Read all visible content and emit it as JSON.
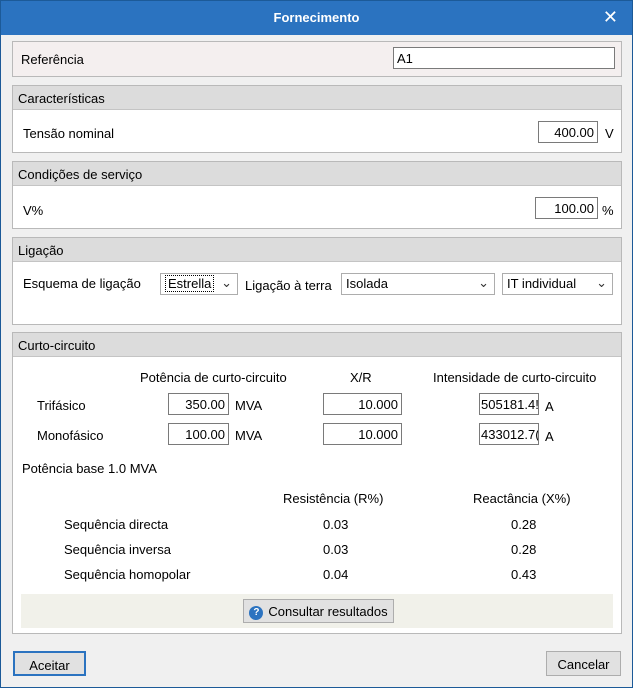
{
  "window": {
    "title": "Fornecimento",
    "close_glyph": "✕"
  },
  "referencia": {
    "label": "Referência",
    "value": "A1"
  },
  "caracteristicas": {
    "header": "Características",
    "tensao_label": "Tensão nominal",
    "tensao_value": "400.00",
    "tensao_unit": "V"
  },
  "condicoes": {
    "header": "Condições de serviço",
    "v_label": "V%",
    "v_value": "100.00",
    "v_unit": "%"
  },
  "ligacao": {
    "header": "Ligação",
    "esquema_label": "Esquema de ligação",
    "esquema_value": "Estrella",
    "terra_label": "Ligação à terra",
    "terra_value": "Isolada",
    "it_value": "IT individual"
  },
  "curto": {
    "header": "Curto-circuito",
    "col_potencia": "Potência de curto-circuito",
    "col_xr": "X/R",
    "col_intensidade": "Intensidade de curto-circuito",
    "rows": [
      {
        "label": "Trifásico",
        "potencia": "350.00",
        "potencia_unit": "MVA",
        "xr": "10.000",
        "intensidade": "505181.4!",
        "intensidade_unit": "A"
      },
      {
        "label": "Monofásico",
        "potencia": "100.00",
        "potencia_unit": "MVA",
        "xr": "10.000",
        "intensidade": "433012.7(",
        "intensidade_unit": "A"
      }
    ],
    "potencia_base": "Potência base  1.0 MVA",
    "col_resistencia": "Resistência (R%)",
    "col_reactancia": "Reactância (X%)",
    "sequences": [
      {
        "label": "Sequência directa",
        "r": "0.03",
        "x": "0.28"
      },
      {
        "label": "Sequência inversa",
        "r": "0.03",
        "x": "0.28"
      },
      {
        "label": "Sequência homopolar",
        "r": "0.04",
        "x": "0.43"
      }
    ],
    "consultar_label": "Consultar resultados"
  },
  "buttons": {
    "aceitar": "Aceitar",
    "cancelar": "Cancelar"
  },
  "colors": {
    "titlebar": "#2b73c0",
    "panel_header": "#dcdcdc",
    "dialog_bg": "#f0f0f0"
  },
  "icons": {
    "close": "close-icon",
    "help": "help-icon",
    "dropdown": "chevron-down-icon"
  }
}
